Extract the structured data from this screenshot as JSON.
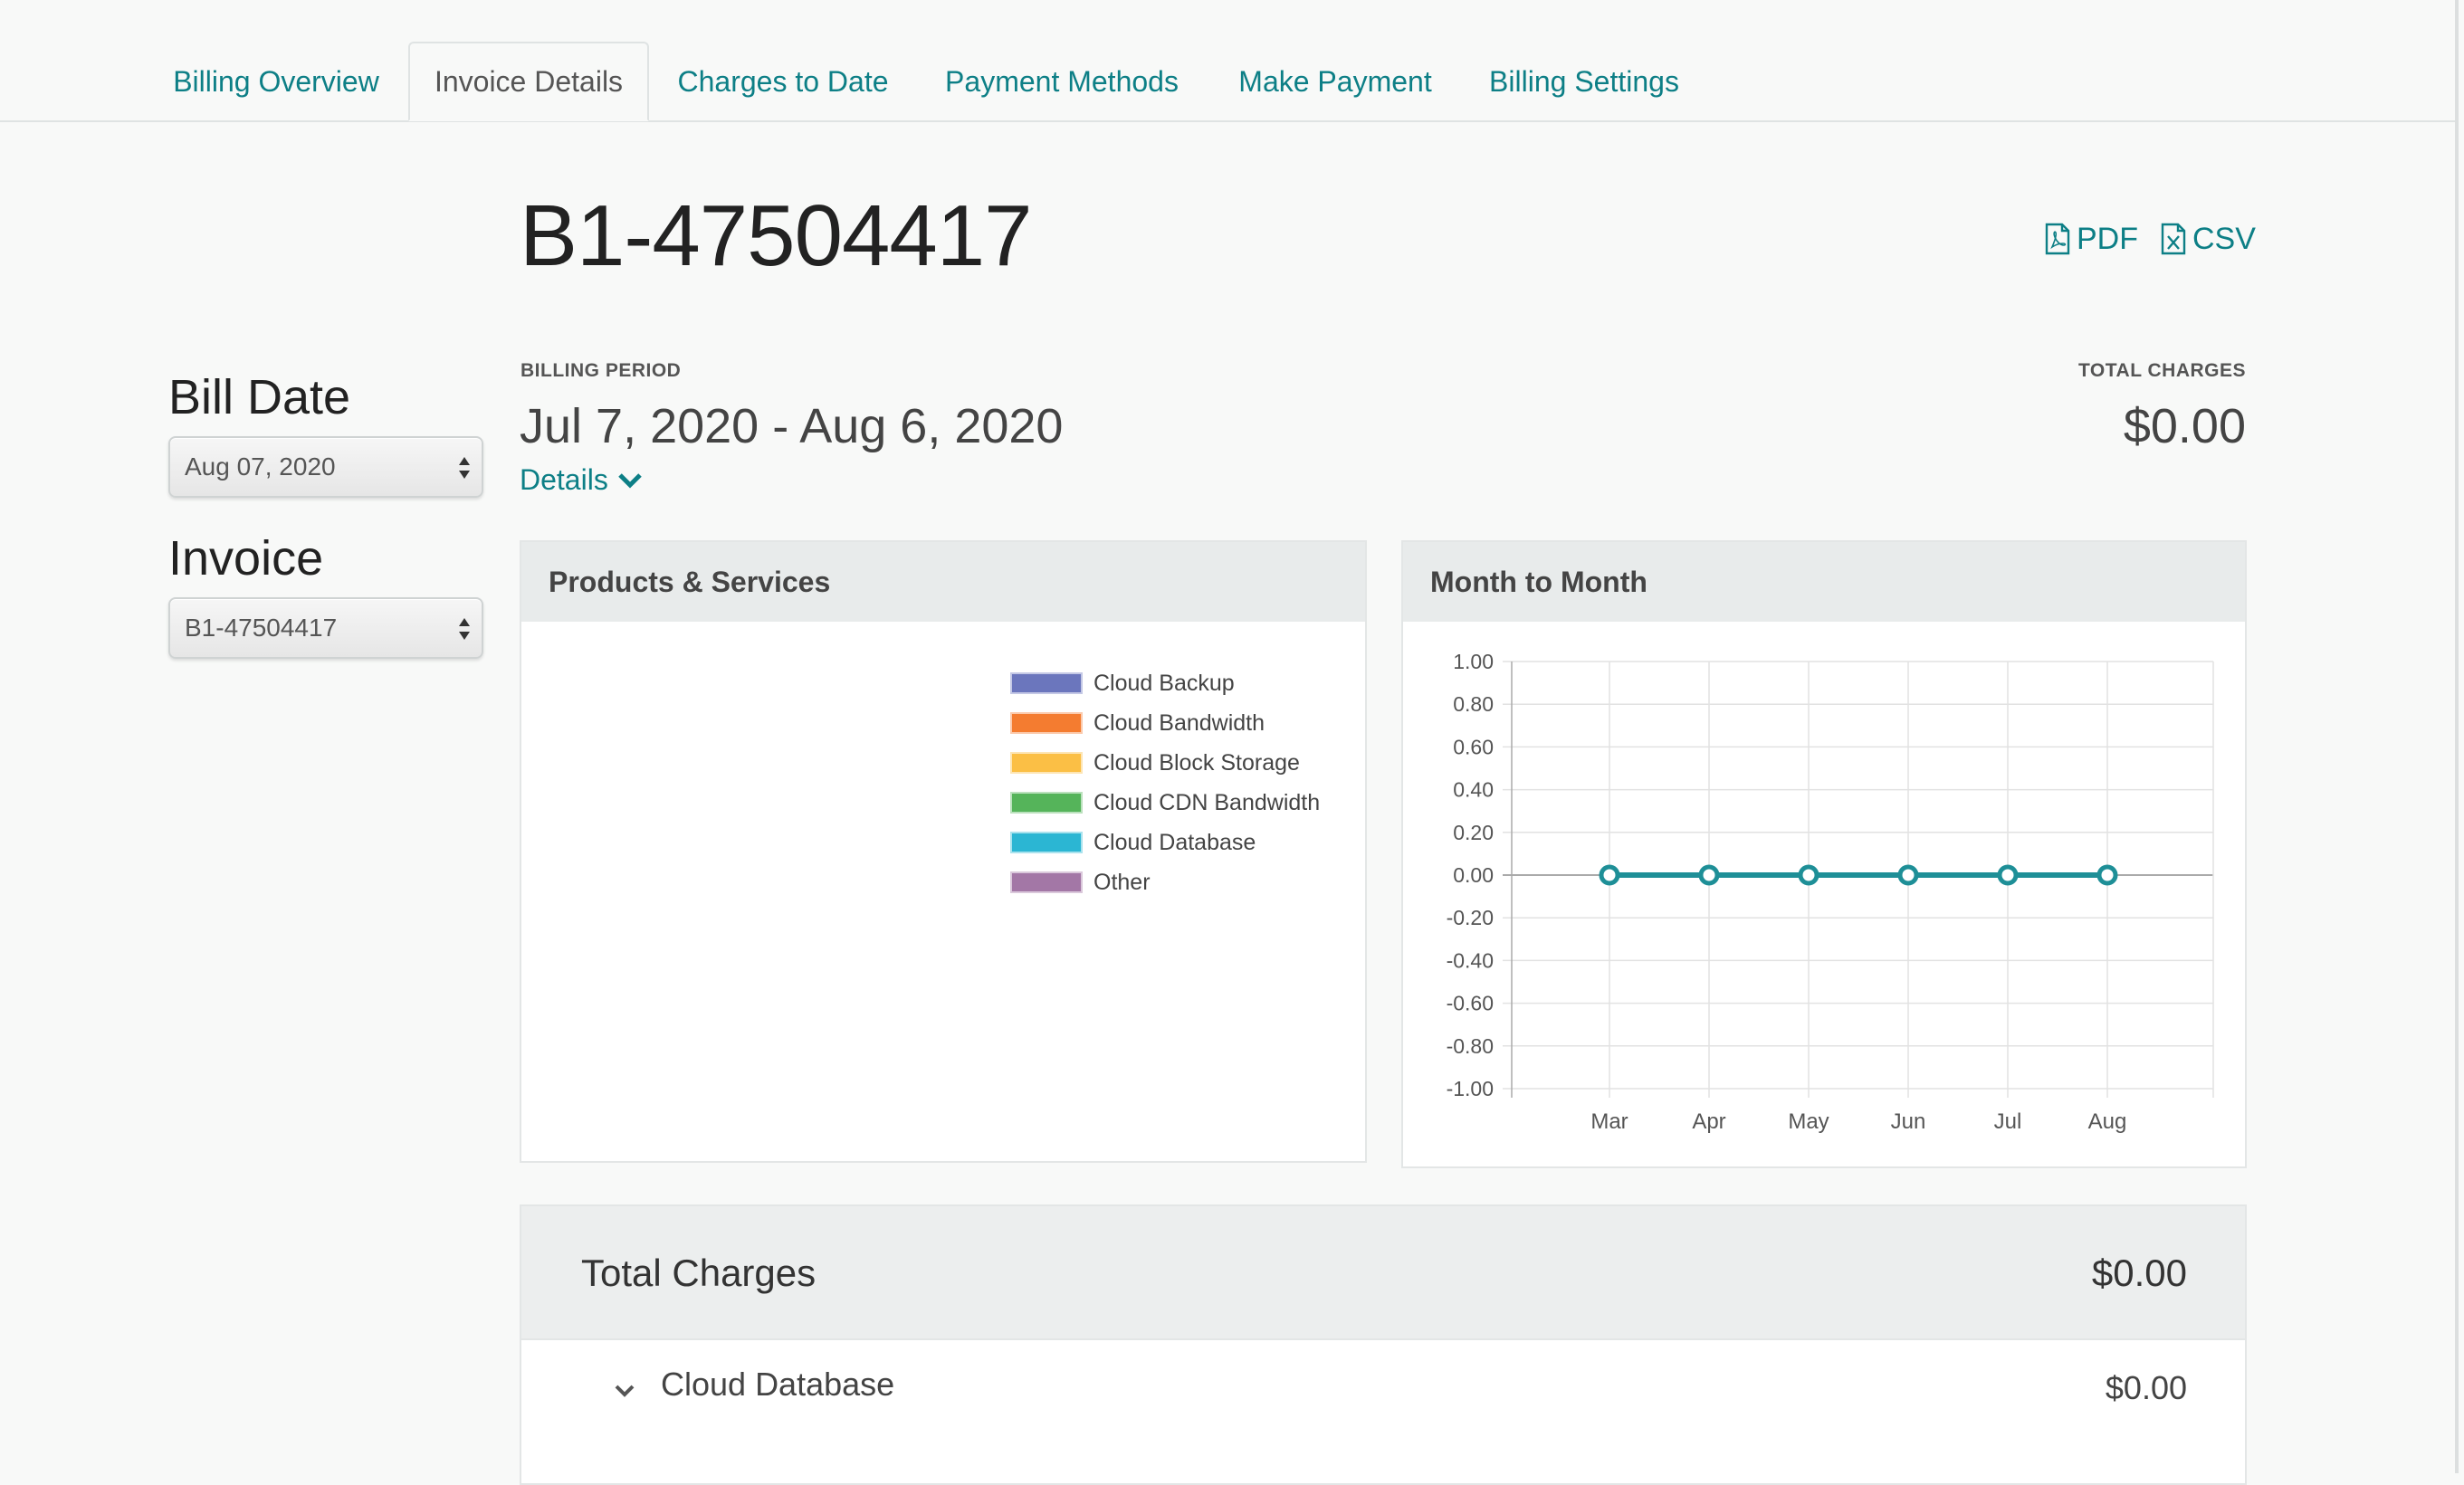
{
  "tabs": [
    {
      "label": "Billing Overview",
      "active": false
    },
    {
      "label": "Invoice Details",
      "active": true
    },
    {
      "label": "Charges to Date",
      "active": false
    },
    {
      "label": "Payment Methods",
      "active": false
    },
    {
      "label": "Make Payment",
      "active": false
    },
    {
      "label": "Billing Settings",
      "active": false
    }
  ],
  "invoice": {
    "number": "B1-47504417",
    "exports": {
      "pdf": "PDF",
      "csv": "CSV"
    }
  },
  "sidebar": {
    "bill_date_label": "Bill Date",
    "bill_date_value": "Aug 07, 2020",
    "invoice_label": "Invoice",
    "invoice_value": "B1-47504417"
  },
  "summary": {
    "billing_period_label": "BILLING PERIOD",
    "billing_period_value": "Jul 7, 2020 - Aug 6, 2020",
    "details_link": "Details",
    "total_charges_label": "TOTAL CHARGES",
    "total_charges_value": "$0.00"
  },
  "products_panel": {
    "title": "Products & Services",
    "legend": [
      {
        "label": "Cloud Backup",
        "color": "#6b76bd"
      },
      {
        "label": "Cloud Bandwidth",
        "color": "#f47c30"
      },
      {
        "label": "Cloud Block Storage",
        "color": "#fbbf45"
      },
      {
        "label": "Cloud CDN Bandwidth",
        "color": "#55b45a"
      },
      {
        "label": "Cloud Database",
        "color": "#2bb6d3"
      },
      {
        "label": "Other",
        "color": "#a377a6"
      }
    ]
  },
  "month_panel": {
    "title": "Month to Month"
  },
  "chart_data": {
    "type": "line",
    "categories": [
      "Mar",
      "Apr",
      "May",
      "Jun",
      "Jul",
      "Aug"
    ],
    "series": [
      {
        "values": [
          0,
          0,
          0,
          0,
          0,
          0
        ],
        "color": "#1e8f97"
      }
    ],
    "ylim": [
      -1.0,
      1.0
    ],
    "yticks": [
      "1.00",
      "0.80",
      "0.60",
      "0.40",
      "0.20",
      "0.00",
      "-0.20",
      "-0.40",
      "-0.60",
      "-0.80",
      "-1.00"
    ],
    "grid": true,
    "title": "",
    "xlabel": "",
    "ylabel": ""
  },
  "totals": {
    "label": "Total Charges",
    "amount": "$0.00",
    "items": [
      {
        "label": "Cloud Database",
        "amount": "$0.00"
      }
    ]
  },
  "colors": {
    "accent": "#0d7f86",
    "line": "#1e8f97"
  }
}
